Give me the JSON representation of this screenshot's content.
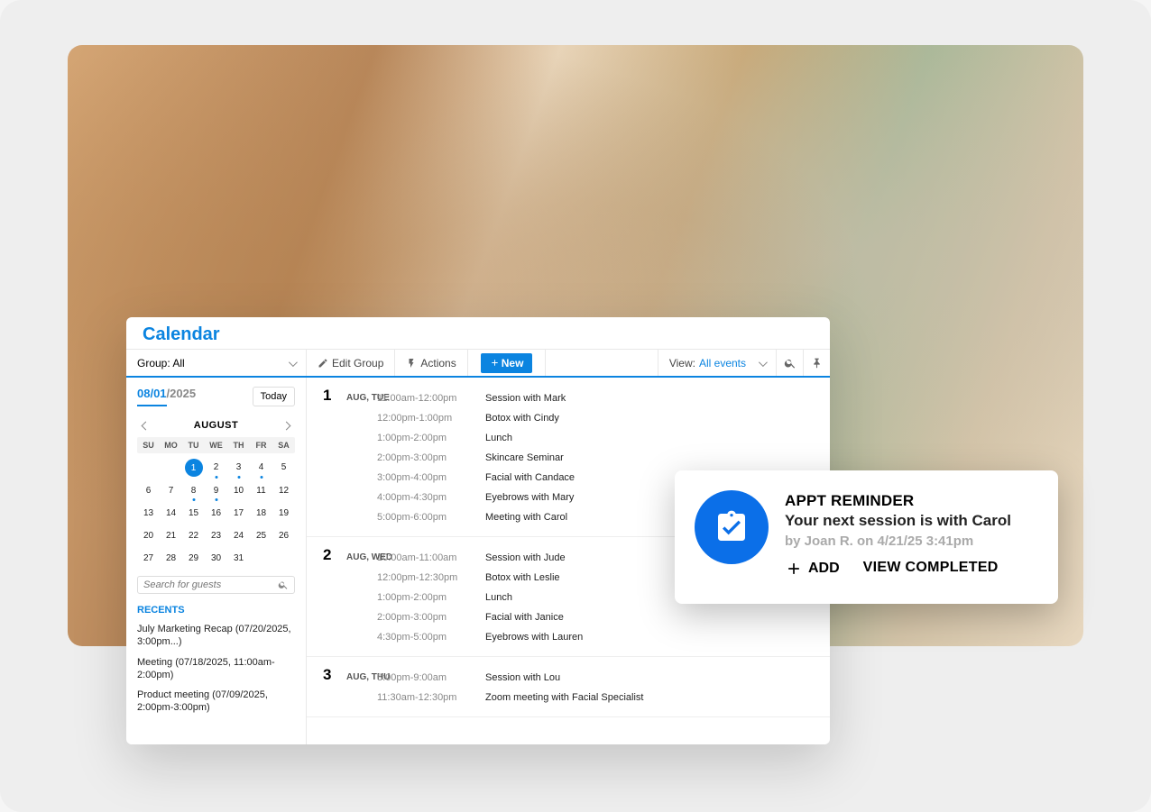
{
  "calendar": {
    "title": "Calendar",
    "toolbar": {
      "group_label": "Group: All",
      "edit_group": "Edit Group",
      "actions": "Actions",
      "new": "New",
      "view_label": "View:",
      "view_value": "All events"
    },
    "sidebar": {
      "date_month": "08/01",
      "date_year": "/2025",
      "today": "Today",
      "month": "AUGUST",
      "dow": [
        "SU",
        "MO",
        "TU",
        "WE",
        "TH",
        "FR",
        "SA"
      ],
      "search_placeholder": "Search for guests",
      "recents_header": "RECENTS",
      "recents": [
        "July Marketing Recap (07/20/2025, 3:00pm...)",
        "Meeting (07/18/2025, 11:00am-2:00pm)",
        "Product meeting (07/09/2025, 2:00pm-3:00pm)"
      ]
    },
    "days": [
      {
        "num": "1",
        "label": "AUG, TUE",
        "events": [
          {
            "time": "11:00am-12:00pm",
            "title": "Session with Mark"
          },
          {
            "time": "12:00pm-1:00pm",
            "title": "Botox with Cindy"
          },
          {
            "time": "1:00pm-2:00pm",
            "title": "Lunch"
          },
          {
            "time": "2:00pm-3:00pm",
            "title": "Skincare Seminar"
          },
          {
            "time": "3:00pm-4:00pm",
            "title": "Facial with Candace"
          },
          {
            "time": "4:00pm-4:30pm",
            "title": "Eyebrows with Mary"
          },
          {
            "time": "5:00pm-6:00pm",
            "title": "Meeting with Carol"
          }
        ]
      },
      {
        "num": "2",
        "label": "AUG, WED",
        "events": [
          {
            "time": "10:00am-11:00am",
            "title": "Session with Jude"
          },
          {
            "time": "12:00pm-12:30pm",
            "title": "Botox with Leslie"
          },
          {
            "time": "1:00pm-2:00pm",
            "title": "Lunch"
          },
          {
            "time": "2:00pm-3:00pm",
            "title": "Facial with Janice"
          },
          {
            "time": "4:30pm-5:00pm",
            "title": "Eyebrows with Lauren"
          }
        ]
      },
      {
        "num": "3",
        "label": "AUG, THU",
        "events": [
          {
            "time": "8:00pm-9:00am",
            "title": "Session with Lou"
          },
          {
            "time": "11:30am-12:30pm",
            "title": "Zoom meeting with Facial Specialist"
          }
        ]
      }
    ]
  },
  "reminder": {
    "title": "APPT REMINDER",
    "subtitle": "Your next session is with Carol",
    "byline": "by Joan R. on 4/21/25 3:41pm",
    "add_label": "ADD",
    "view_label": "VIEW COMPLETED"
  }
}
